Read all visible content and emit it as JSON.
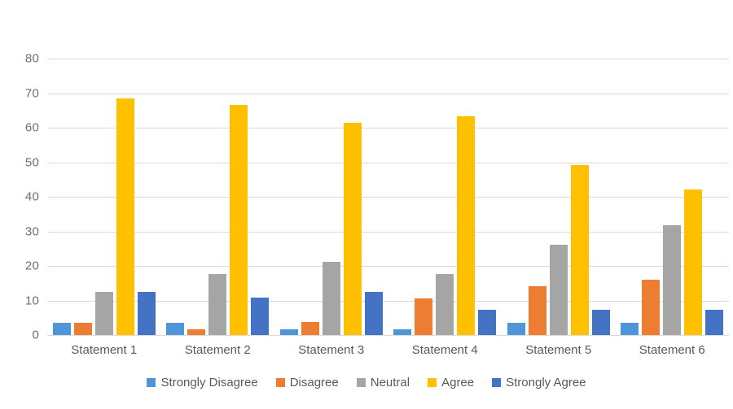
{
  "chart_data": {
    "type": "bar",
    "title": "",
    "subtitle": "",
    "xlabel": "",
    "ylabel": "",
    "ylim": [
      0,
      80
    ],
    "ytick_labels": [
      "80",
      "70",
      "60",
      "50",
      "40",
      "30",
      "20",
      "10",
      "0"
    ],
    "ytick_values": [
      80,
      70,
      60,
      50,
      40,
      30,
      20,
      10,
      0
    ],
    "grid": true,
    "legend_position": "bottom",
    "categories": [
      "Statement 1",
      "Statement 2",
      "Statement 3",
      "Statement 4",
      "Statement 5",
      "Statement 6"
    ],
    "series": [
      {
        "name": "Strongly Disagree",
        "color": "#4E95D9",
        "values": [
          3.6,
          3.6,
          1.6,
          1.6,
          3.5,
          3.5
        ]
      },
      {
        "name": "Disagree",
        "color": "#ED7D31",
        "values": [
          3.6,
          1.6,
          3.7,
          10.7,
          14.1,
          15.9
        ]
      },
      {
        "name": "Neutral",
        "color": "#A5A5A5",
        "values": [
          12.4,
          17.7,
          21.1,
          17.7,
          26.2,
          31.7
        ]
      },
      {
        "name": "Agree",
        "color": "#FFC000",
        "values": [
          68.4,
          66.5,
          61.3,
          63.3,
          49.1,
          42.2
        ]
      },
      {
        "name": "Strongly Agree",
        "color": "#4472C4",
        "values": [
          12.4,
          10.8,
          12.5,
          7.2,
          7.2,
          7.2
        ]
      }
    ]
  },
  "axis": {
    "y_axis_name": "y-axis",
    "x_axis_name": "x-axis"
  },
  "legend": {
    "entries": [
      {
        "label": "Strongly Disagree",
        "color": "#4E95D9"
      },
      {
        "label": "Disagree",
        "color": "#ED7D31"
      },
      {
        "label": "Neutral",
        "color": "#A5A5A5"
      },
      {
        "label": "Agree",
        "color": "#FFC000"
      },
      {
        "label": "Strongly Agree",
        "color": "#4472C4"
      }
    ]
  },
  "style": {
    "gridline_color": "#d9d9d9",
    "label_color": "#595959",
    "tick_color": "#6e6e6e",
    "background": "#ffffff"
  }
}
